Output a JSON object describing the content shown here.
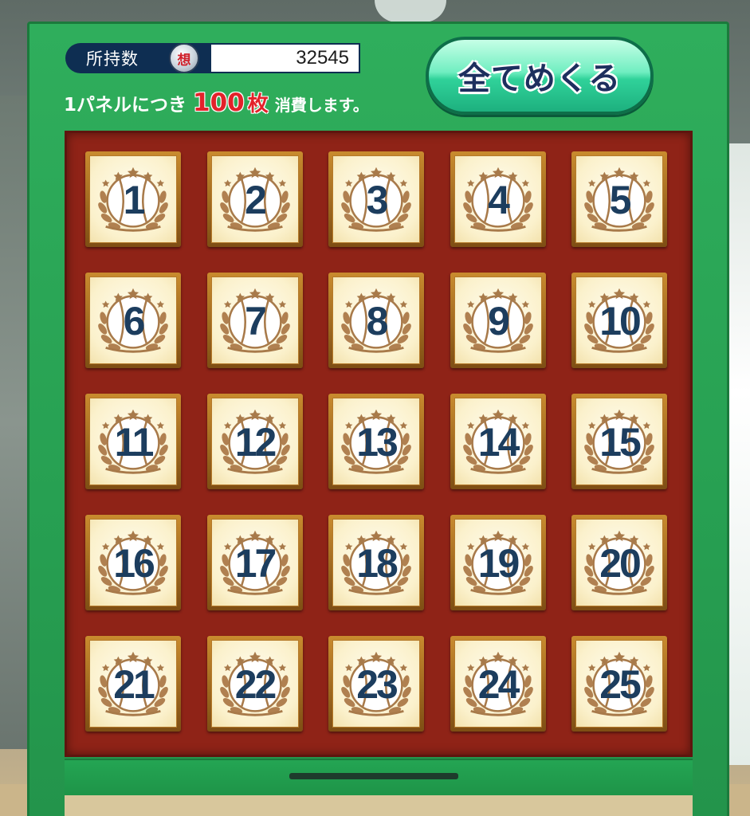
{
  "header": {
    "coin_label": "所持数",
    "coin_icon_glyph": "想",
    "coin_value": "32545",
    "cost_prefix": "1パネルにつき",
    "cost_amount": "100",
    "cost_unit": "枚",
    "cost_suffix": "消費します。"
  },
  "flip_all_button": {
    "label": "全てめくる"
  },
  "panels": [
    {
      "number": "1"
    },
    {
      "number": "2"
    },
    {
      "number": "3"
    },
    {
      "number": "4"
    },
    {
      "number": "5"
    },
    {
      "number": "6"
    },
    {
      "number": "7"
    },
    {
      "number": "8"
    },
    {
      "number": "9"
    },
    {
      "number": "10"
    },
    {
      "number": "11"
    },
    {
      "number": "12"
    },
    {
      "number": "13"
    },
    {
      "number": "14"
    },
    {
      "number": "15"
    },
    {
      "number": "16"
    },
    {
      "number": "17"
    },
    {
      "number": "18"
    },
    {
      "number": "19"
    },
    {
      "number": "20"
    },
    {
      "number": "21"
    },
    {
      "number": "22"
    },
    {
      "number": "23"
    },
    {
      "number": "24"
    },
    {
      "number": "25"
    }
  ],
  "colors": {
    "frame_green": "#27a052",
    "board_red": "#8f2317",
    "panel_face": "#fbf1cc",
    "number_navy": "#1c3d5e",
    "cost_red": "#e3222a"
  },
  "icons": {
    "panel_emblem": "laurel-wreath-baseball-icon",
    "coin": "coin-icon"
  }
}
